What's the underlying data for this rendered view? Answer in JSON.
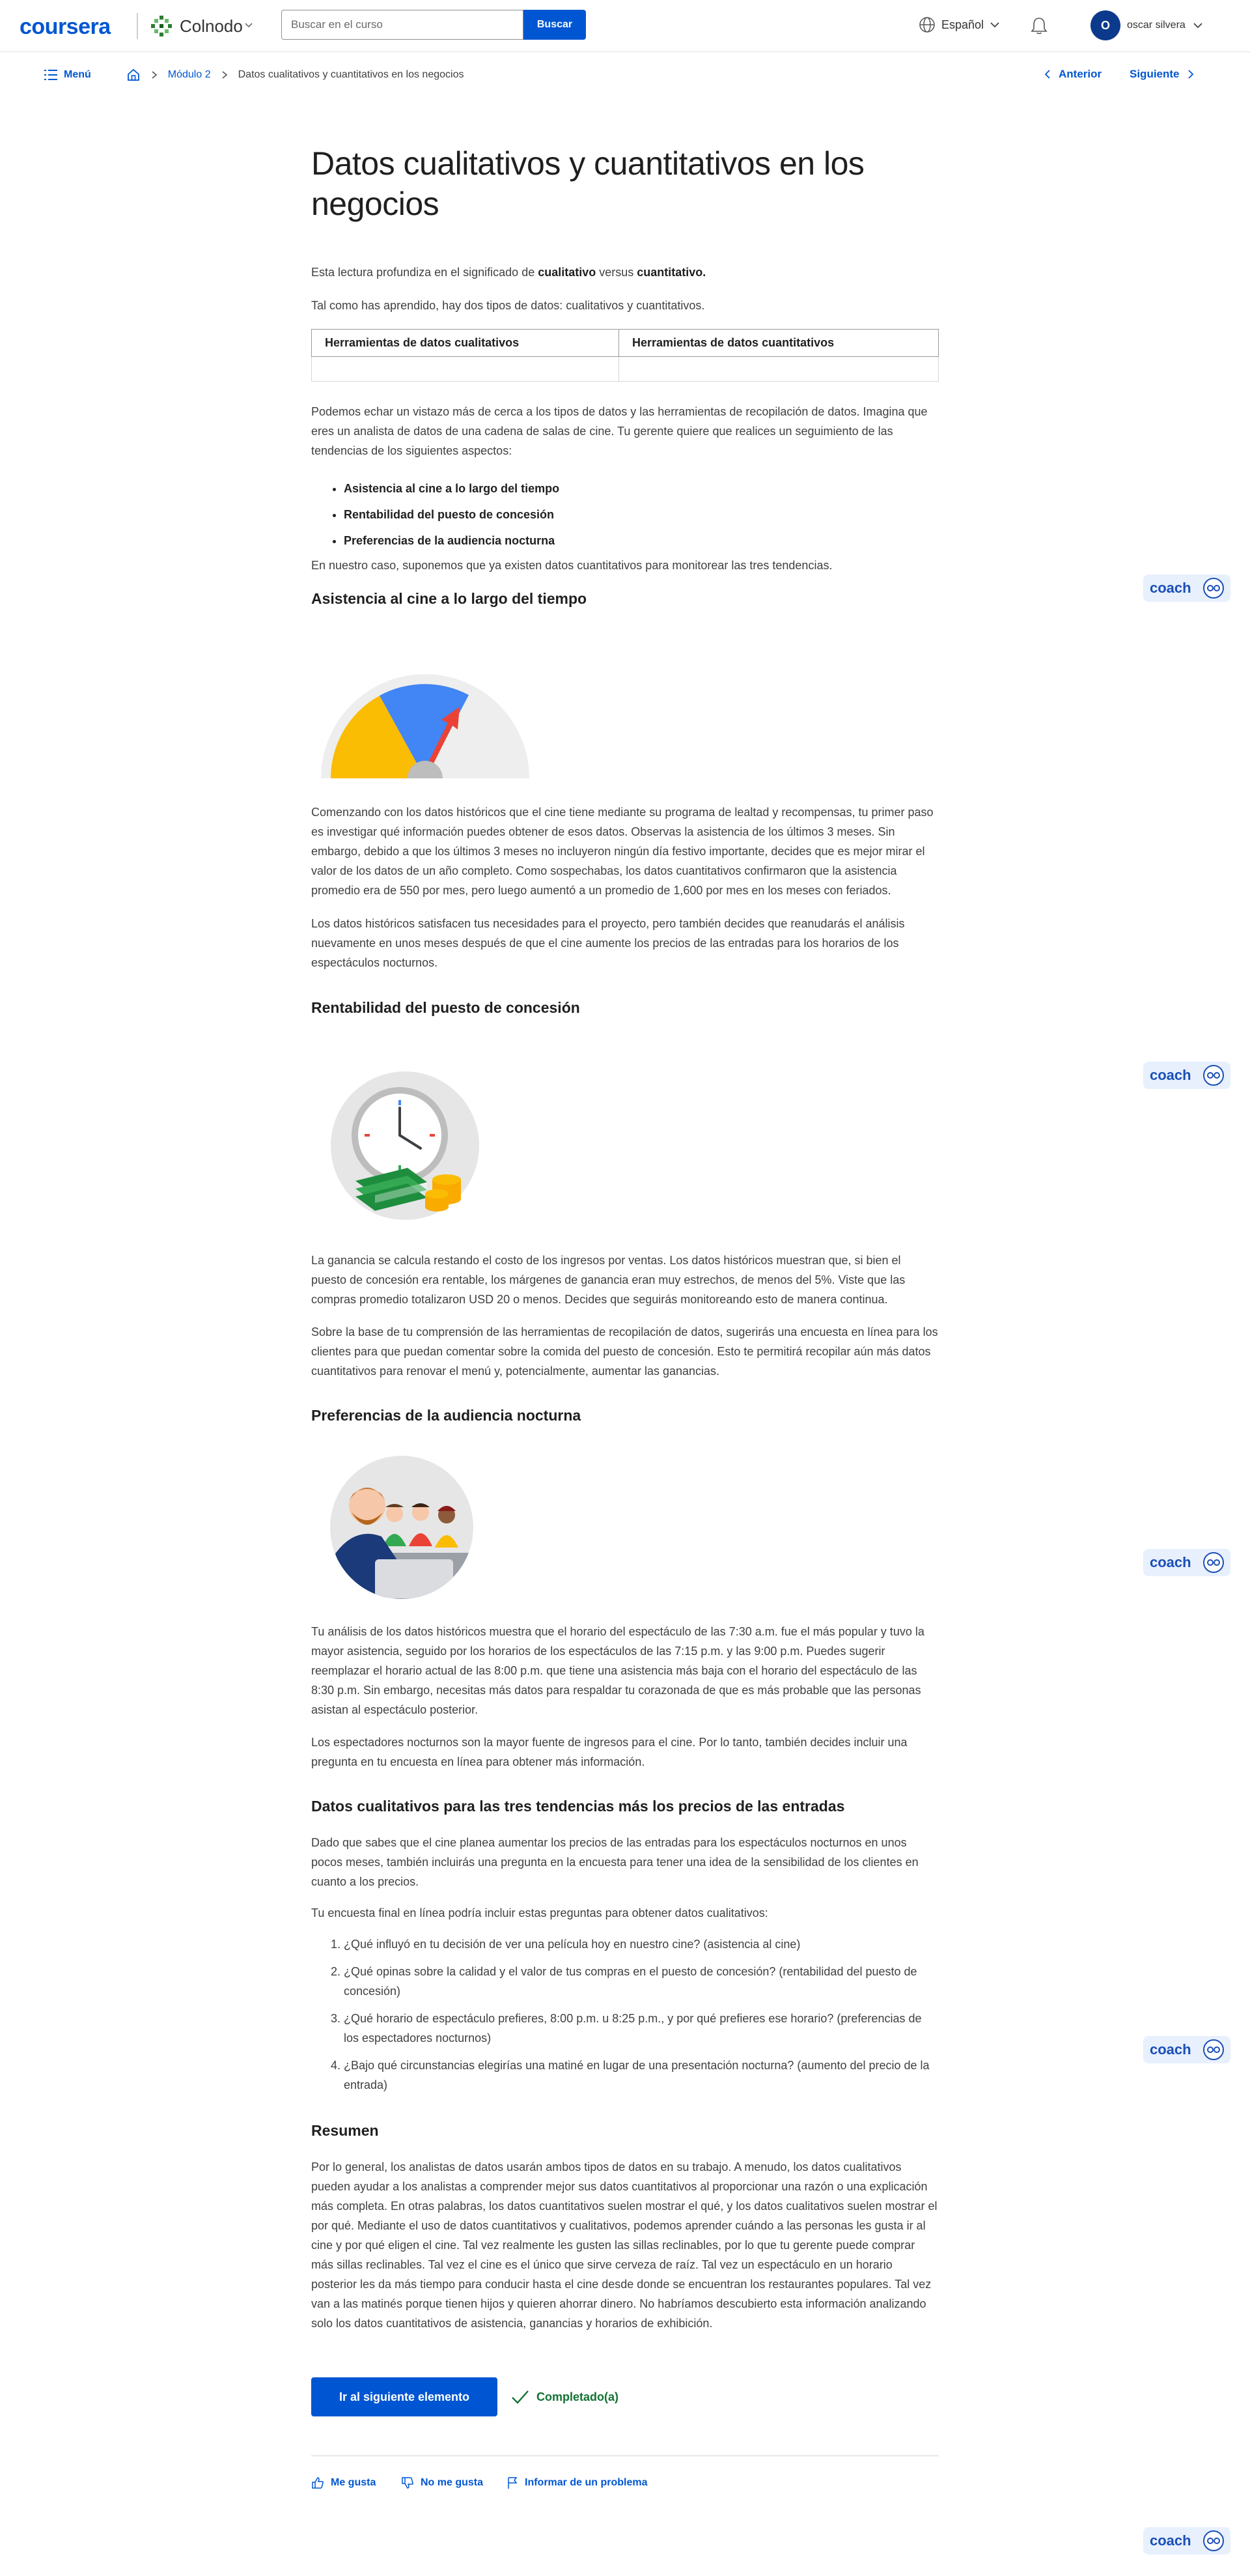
{
  "header": {
    "brand": "coursera",
    "partner": "Colnodo",
    "search_placeholder": "Buscar en el curso",
    "search_button": "Buscar",
    "language": "Español",
    "user_initial": "O",
    "user_name": "oscar silvera"
  },
  "breadcrumb": {
    "menu": "Menú",
    "module": "Módulo 2",
    "current": "Datos cualitativos y cuantitativos en los negocios",
    "prev": "Anterior",
    "next": "Siguiente"
  },
  "article": {
    "title": "Datos cualitativos y cuantitativos en los negocios",
    "intro_pre": "Esta lectura profundiza en el significado de ",
    "intro_b1": "cualitativo",
    "intro_mid": " versus ",
    "intro_b2": "cuantitativo.",
    "types": "Tal como has aprendido, hay dos tipos de datos: cualitativos y cuantitativos.",
    "table_headers": [
      "Herramientas de datos cualitativos",
      "Herramientas de datos cuantitativos"
    ],
    "scenario": "Podemos echar un vistazo más de cerca a los tipos de datos y las herramientas de recopilación de datos. Imagina que eres un analista de datos de una cadena de salas de cine. Tu gerente quiere que realices un seguimiento de las tendencias de los siguientes aspectos:",
    "trends": [
      "Asistencia al cine a lo largo del tiempo",
      "Rentabilidad del puesto de concesión",
      "Preferencias de la audiencia nocturna"
    ],
    "assume": "En nuestro caso, suponemos que ya existen datos cuantitativos para monitorear las tres tendencias.",
    "s1_title": "Asistencia al cine a lo largo del tiempo",
    "s1_p1": "Comenzando con los datos históricos que el cine tiene mediante su programa de lealtad y recompensas, tu primer paso es investigar qué información puedes obtener de esos datos. Observas la asistencia de los últimos 3 meses. Sin embargo, debido a que los últimos 3 meses no incluyeron ningún día festivo importante, decides que es mejor mirar el valor de los datos de un año completo. Como sospechabas, los datos cuantitativos confirmaron que la asistencia promedio era de 550 por mes, pero luego aumentó a un promedio de 1,600 por mes en los meses con feriados.",
    "s1_p2": "Los datos históricos satisfacen tus necesidades para el proyecto, pero también decides que reanudarás el análisis nuevamente en unos meses después de que el cine aumente los precios de las entradas para los horarios de los espectáculos nocturnos.",
    "s2_title": "Rentabilidad del puesto de concesión",
    "s2_p1": "La ganancia se calcula restando el costo de los ingresos por ventas. Los datos históricos muestran que, si bien el puesto de concesión era rentable, los márgenes de ganancia eran muy estrechos, de menos del 5%. Viste que las compras promedio totalizaron USD 20 o menos. Decides que seguirás monitoreando esto de manera continua.",
    "s2_p2": "Sobre la base de tu comprensión de las herramientas de recopilación de datos, sugerirás una encuesta en línea para los clientes para que puedan comentar sobre la comida del puesto de concesión. Esto te permitirá recopilar aún más datos cuantitativos para renovar el menú y, potencialmente, aumentar las ganancias.",
    "s3_title": "Preferencias de la audiencia nocturna",
    "s3_p1": "Tu análisis de los datos históricos muestra que el horario del espectáculo de las 7:30 a.m. fue el más popular y tuvo la mayor asistencia, seguido por los horarios de los espectáculos de las 7:15 p.m. y las 9:00 p.m. Puedes sugerir reemplazar el horario actual de las 8:00 p.m. que tiene una asistencia más baja con el horario del espectáculo de las 8:30 p.m. Sin embargo, necesitas más datos para respaldar tu corazonada de que es más probable que las personas asistan al espectáculo posterior.",
    "s3_p2": "Los espectadores nocturnos son la mayor fuente de ingresos para el cine. Por lo tanto, también decides incluir una pregunta en tu encuesta en línea para obtener más información.",
    "s4_title": "Datos cualitativos para las tres tendencias más los precios de las entradas",
    "s4_p1": "Dado que sabes que el cine planea aumentar los precios de las entradas para los espectáculos nocturnos en unos pocos meses, también incluirás una pregunta en la encuesta para tener una idea de la sensibilidad de los clientes en cuanto a los precios.",
    "s4_p2": "Tu encuesta final en línea podría incluir estas preguntas para obtener datos cualitativos:",
    "questions": [
      "¿Qué influyó en tu decisión de ver una película hoy en nuestro cine? (asistencia al cine)",
      "¿Qué opinas sobre la calidad y el valor de tus compras en el puesto de concesión? (rentabilidad del puesto de concesión)",
      "¿Qué horario de espectáculo prefieres, 8:00 p.m. u 8:25 p.m., y por qué prefieres ese horario? (preferencias de los espectadores nocturnos)",
      "¿Bajo qué circunstancias elegirías una matiné en lugar de una presentación nocturna? (aumento del precio de la entrada)"
    ],
    "s5_title": "Resumen",
    "s5_p1": "Por lo general, los analistas de datos usarán ambos tipos de datos en su trabajo. A menudo, los datos cualitativos pueden ayudar a los analistas a comprender mejor sus datos cuantitativos al proporcionar una razón o una explicación más completa. En otras palabras, los datos cuantitativos suelen mostrar el qué, y los datos cualitativos suelen mostrar el por qué. Mediante el uso de datos cuantitativos y cualitativos, podemos aprender cuándo a las personas les gusta ir al cine y por qué eligen el cine. Tal vez realmente les gusten las sillas reclinables, por lo que tu gerente puede comprar más sillas reclinables. Tal vez el cine es el único que sirve cerveza de raíz. Tal vez un espectáculo en un horario posterior les da más tiempo para conducir hasta el cine desde donde se encuentran los restaurantes populares. Tal vez van a las matinés porque tienen hijos y quieren ahorrar dinero. No habríamos descubierto esta información analizando solo los datos cuantitativos de asistencia, ganancias y horarios de exhibición."
  },
  "footer": {
    "next_item": "Ir al siguiente elemento",
    "completed": "Completado(a)",
    "like": "Me gusta",
    "dislike": "No me gusta",
    "report": "Informar de un problema"
  },
  "coach": {
    "label": "coach"
  },
  "colors": {
    "primary": "#0056d2",
    "success": "#137333",
    "gauge_yellow": "#fbbc04",
    "gauge_blue": "#4285f4",
    "gauge_red": "#ea4335"
  }
}
